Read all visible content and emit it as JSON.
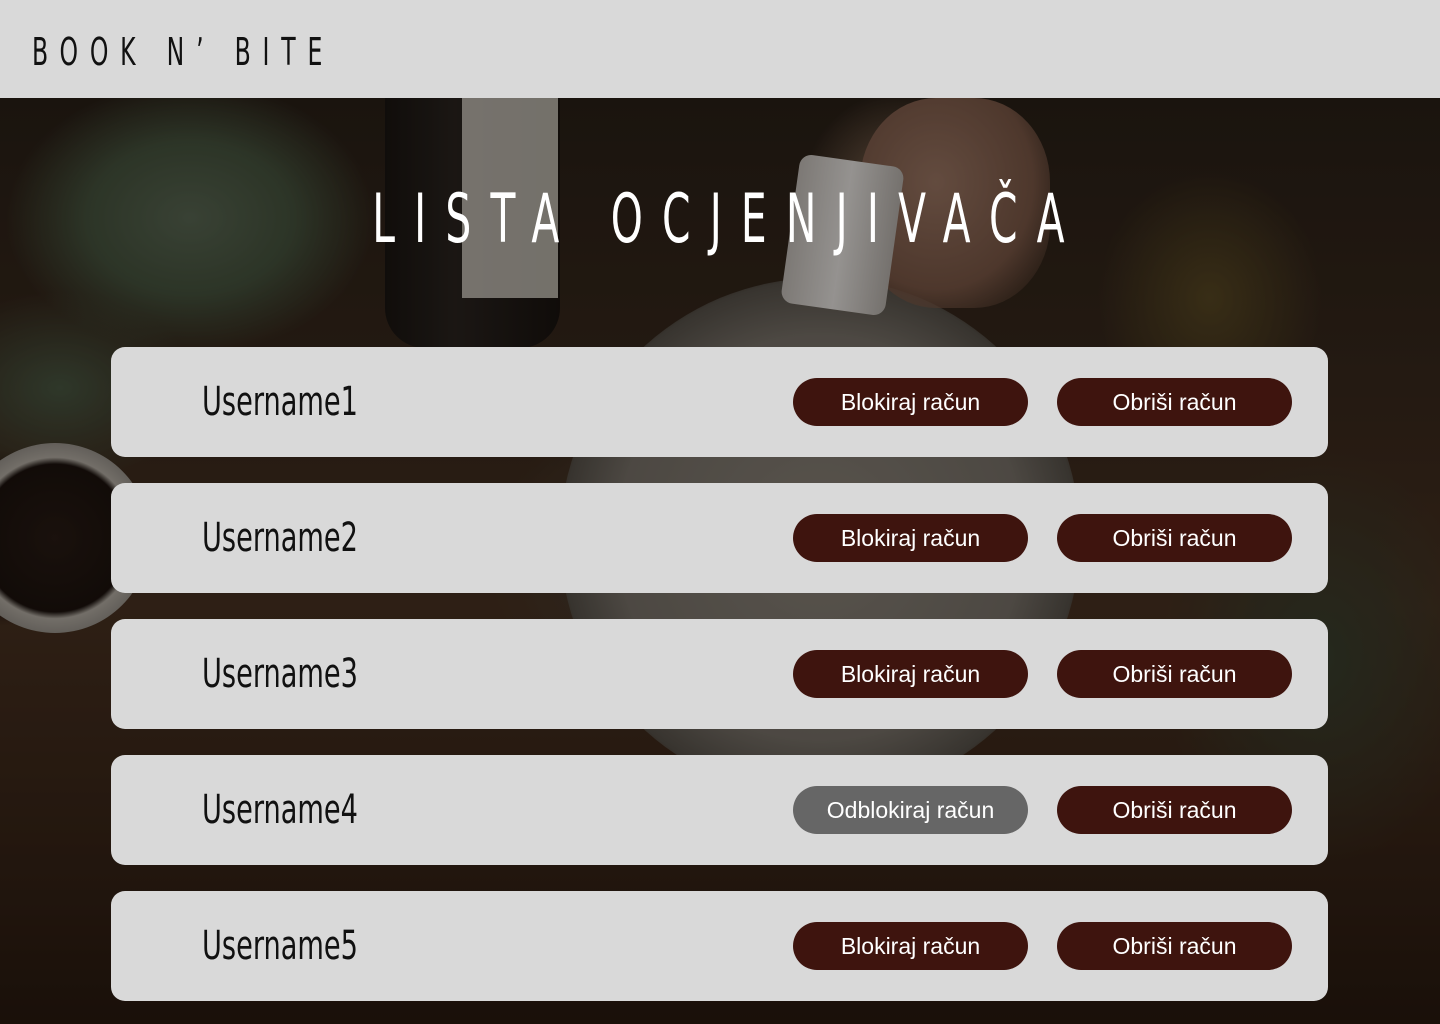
{
  "header": {
    "brand": "BOOK N’ BITE"
  },
  "page": {
    "title": "LISTA OCJENJIVAČA"
  },
  "reviewers": [
    {
      "username": "Username1",
      "block_label": "Blokiraj račun",
      "delete_label": "Obriši račun",
      "blocked": false
    },
    {
      "username": "Username2",
      "block_label": "Blokiraj račun",
      "delete_label": "Obriši račun",
      "blocked": false
    },
    {
      "username": "Username3",
      "block_label": "Blokiraj račun",
      "delete_label": "Obriši račun",
      "blocked": false
    },
    {
      "username": "Username4",
      "block_label": "Odblokiraj račun",
      "delete_label": "Obriši račun",
      "blocked": true
    },
    {
      "username": "Username5",
      "block_label": "Blokiraj račun",
      "delete_label": "Obriši račun",
      "blocked": false
    }
  ],
  "colors": {
    "header_bg": "#d9d9d9",
    "card_bg": "#d9d9d9",
    "button_primary": "#3e140e",
    "button_unblock": "#666666",
    "title_text": "#ffffff"
  }
}
